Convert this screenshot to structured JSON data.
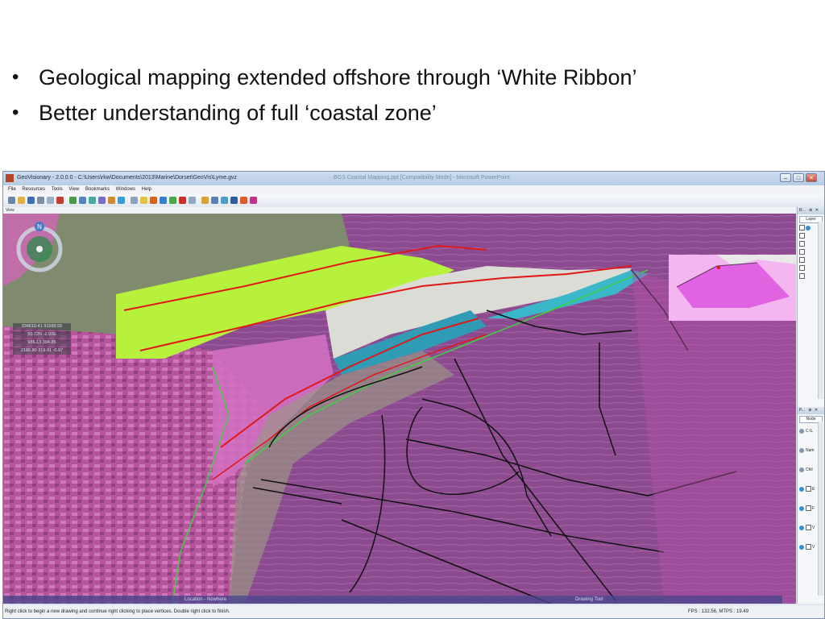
{
  "slide": {
    "bullets": [
      "Geological mapping extended offshore through ‘White Ribbon’",
      "Better understanding of full ‘coastal zone’"
    ]
  },
  "window": {
    "title": "GeoVisionary - 2.0.0.0 - C:\\Users\\rkw\\Documents\\2013\\Marine\\Dorset\\GeoVis\\Lyme.gvz",
    "ghost_title": "BGS Coastal Mapping.ppt [Compatibility Mode] - Microsoft PowerPoint",
    "controls": {
      "minimize": "–",
      "maximize": "□",
      "close": "✕"
    },
    "menu": [
      "File",
      "Resources",
      "Tools",
      "View",
      "Bookmarks",
      "Windows",
      "Help"
    ],
    "view_label": "View"
  },
  "overlay": {
    "compass_north": "N",
    "readouts": [
      "334610.41 91589.55",
      "50.72N -2.93E",
      "985.13 394.85",
      "2186.80 319.91 -0.97"
    ],
    "location_label": "Location - Nowhere",
    "drawing_label": "Drawing Tool"
  },
  "status": {
    "message": "Right click to begin a new drawing and continue right clicking to place vertices. Double right click to finish.",
    "fps": "FPS : 132.56, MTPS : 19.49"
  },
  "layers_panel": {
    "header": "R...",
    "pin": "⊕",
    "close": "✕",
    "tab": "Layer"
  },
  "props_panel": {
    "header": "P...",
    "pin": "⊕",
    "close": "✕",
    "tab": "Node",
    "rows": [
      {
        "label": "C:\\L",
        "checkbox": false
      },
      {
        "label": "Nam",
        "checkbox": false
      },
      {
        "label": "Chil",
        "checkbox": false
      },
      {
        "label": "E",
        "checkbox": true
      },
      {
        "label": "F",
        "checkbox": true
      },
      {
        "label": "V",
        "checkbox": true
      },
      {
        "label": "V",
        "checkbox": true
      }
    ]
  },
  "colors": {
    "land_relief": "#b6559d",
    "sea_bed": "#8c4b8e",
    "lias_green": "#b6f23b",
    "chalk_white": "#dcdcd6",
    "blue_unit": "#2f9bb4",
    "mapped_line_red": "#e01818",
    "contour_green": "#3fd13f",
    "seabed_lines": "#101010"
  }
}
